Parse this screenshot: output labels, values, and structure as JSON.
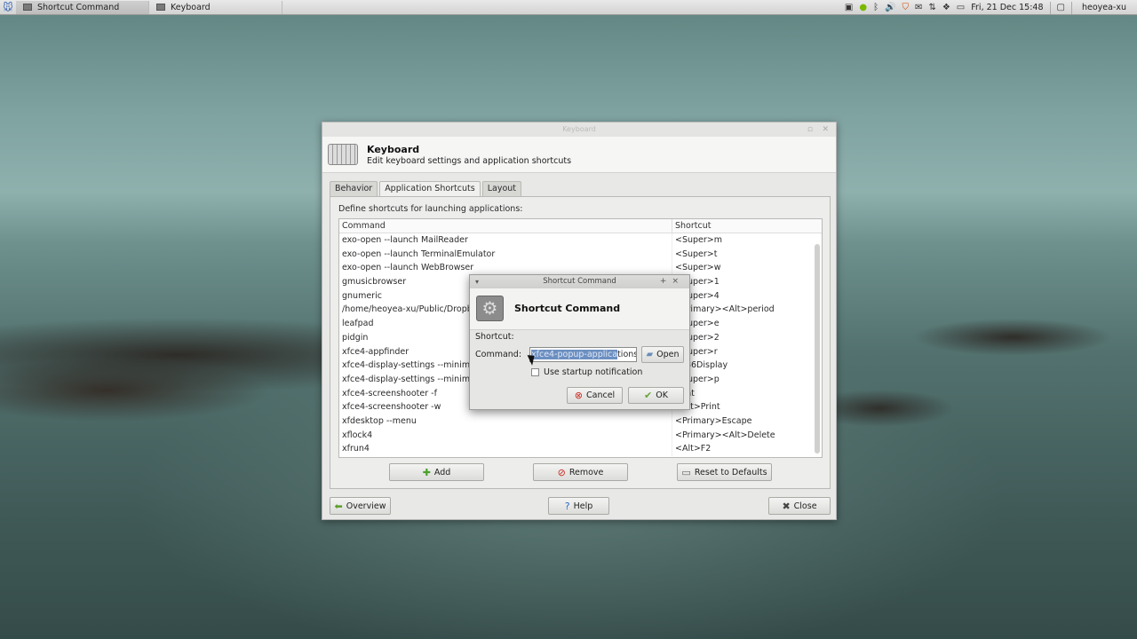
{
  "panel": {
    "menu_icon": "xfce-mouse-icon",
    "tasks": [
      {
        "label": "Shortcut Command",
        "active": true
      },
      {
        "label": "Keyboard",
        "active": false
      }
    ],
    "clock": "Fri, 21 Dec  15:48",
    "user": "heoyea-xu"
  },
  "keyboard_window": {
    "titlebar": "Keyboard",
    "header_title": "Keyboard",
    "header_subtitle": "Edit keyboard settings and application shortcuts",
    "tabs": [
      "Behavior",
      "Application Shortcuts",
      "Layout"
    ],
    "active_tab": "Application Shortcuts",
    "description": "Define shortcuts for launching applications:",
    "columns": [
      "Command",
      "Shortcut"
    ],
    "rows": [
      {
        "command": "exo-open --launch MailReader",
        "shortcut": "<Super>m"
      },
      {
        "command": "exo-open --launch TerminalEmulator",
        "shortcut": "<Super>t"
      },
      {
        "command": "exo-open --launch WebBrowser",
        "shortcut": "<Super>w"
      },
      {
        "command": "gmusicbrowser",
        "shortcut": "<Super>1"
      },
      {
        "command": "gnumeric",
        "shortcut": "<Super>4"
      },
      {
        "command": "/home/heoyea-xu/Public/Dropbox",
        "shortcut": "<Primary><Alt>period"
      },
      {
        "command": "leafpad",
        "shortcut": "<Super>e"
      },
      {
        "command": "pidgin",
        "shortcut": "<Super>2"
      },
      {
        "command": "xfce4-appfinder",
        "shortcut": "<Super>r"
      },
      {
        "command": "xfce4-display-settings --minimal",
        "shortcut": "XF86Display"
      },
      {
        "command": "xfce4-display-settings --minimal",
        "shortcut": "<Super>p"
      },
      {
        "command": "xfce4-screenshooter -f",
        "shortcut": "Print"
      },
      {
        "command": "xfce4-screenshooter -w",
        "shortcut": "<Alt>Print"
      },
      {
        "command": "xfdesktop --menu",
        "shortcut": "<Primary>Escape"
      },
      {
        "command": "xflock4",
        "shortcut": "<Primary><Alt>Delete"
      },
      {
        "command": "xfrun4",
        "shortcut": "<Alt>F2"
      }
    ],
    "buttons": {
      "add": "Add",
      "remove": "Remove",
      "reset": "Reset to Defaults",
      "overview": "Overview",
      "help": "Help",
      "close": "Close"
    }
  },
  "shortcut_dialog": {
    "titlebar": "Shortcut Command",
    "header_title": "Shortcut Command",
    "shortcut_label": "Shortcut:",
    "command_label": "Command:",
    "command_value_selected": "xfce4-popup-applica",
    "command_value_rest": "tions",
    "open_button": "Open",
    "startup_notification": "Use startup notification",
    "startup_notification_checked": false,
    "cancel_button": "Cancel",
    "ok_button": "OK"
  }
}
